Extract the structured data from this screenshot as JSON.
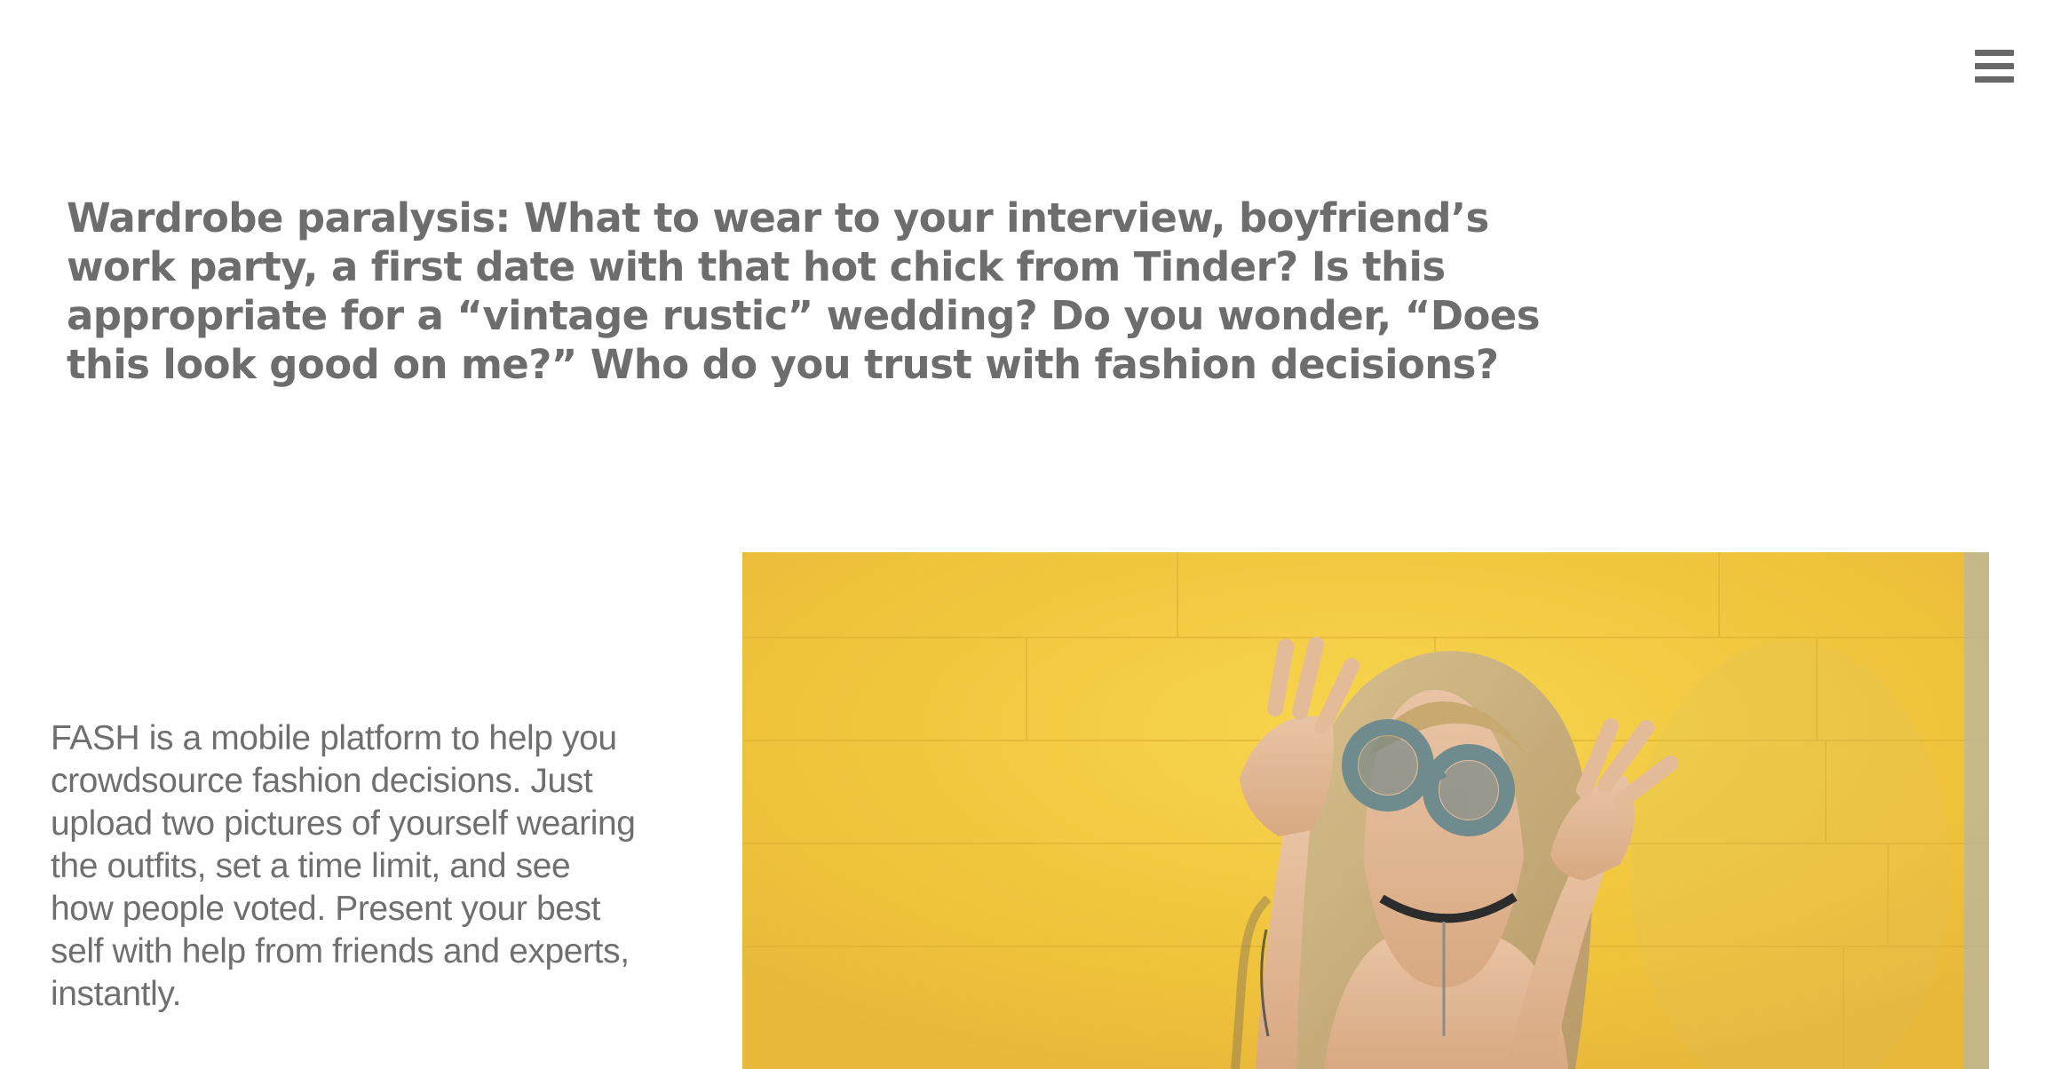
{
  "header": {
    "menu_icon": "hamburger-menu-icon"
  },
  "hero": {
    "headline": "Wardrobe paralysis: What to wear to your interview, boyfriend’s work party, a first date with that hot chick from Tinder? Is this appropriate for a “vintage rustic” wedding? Do you wonder, “Does this look good on me?” Who do you trust with fashion decisions?",
    "description": "FASH is a mobile platform to help you crowdsource fashion decisions. Just upload two pictures of yourself wearing the outfits, set a time limit, and see how people voted. Present your best self with help from friends and experts, instantly."
  },
  "colors": {
    "text": "#6d6d6d",
    "background": "#ffffff",
    "hero_yellow": "#f0c63d"
  }
}
